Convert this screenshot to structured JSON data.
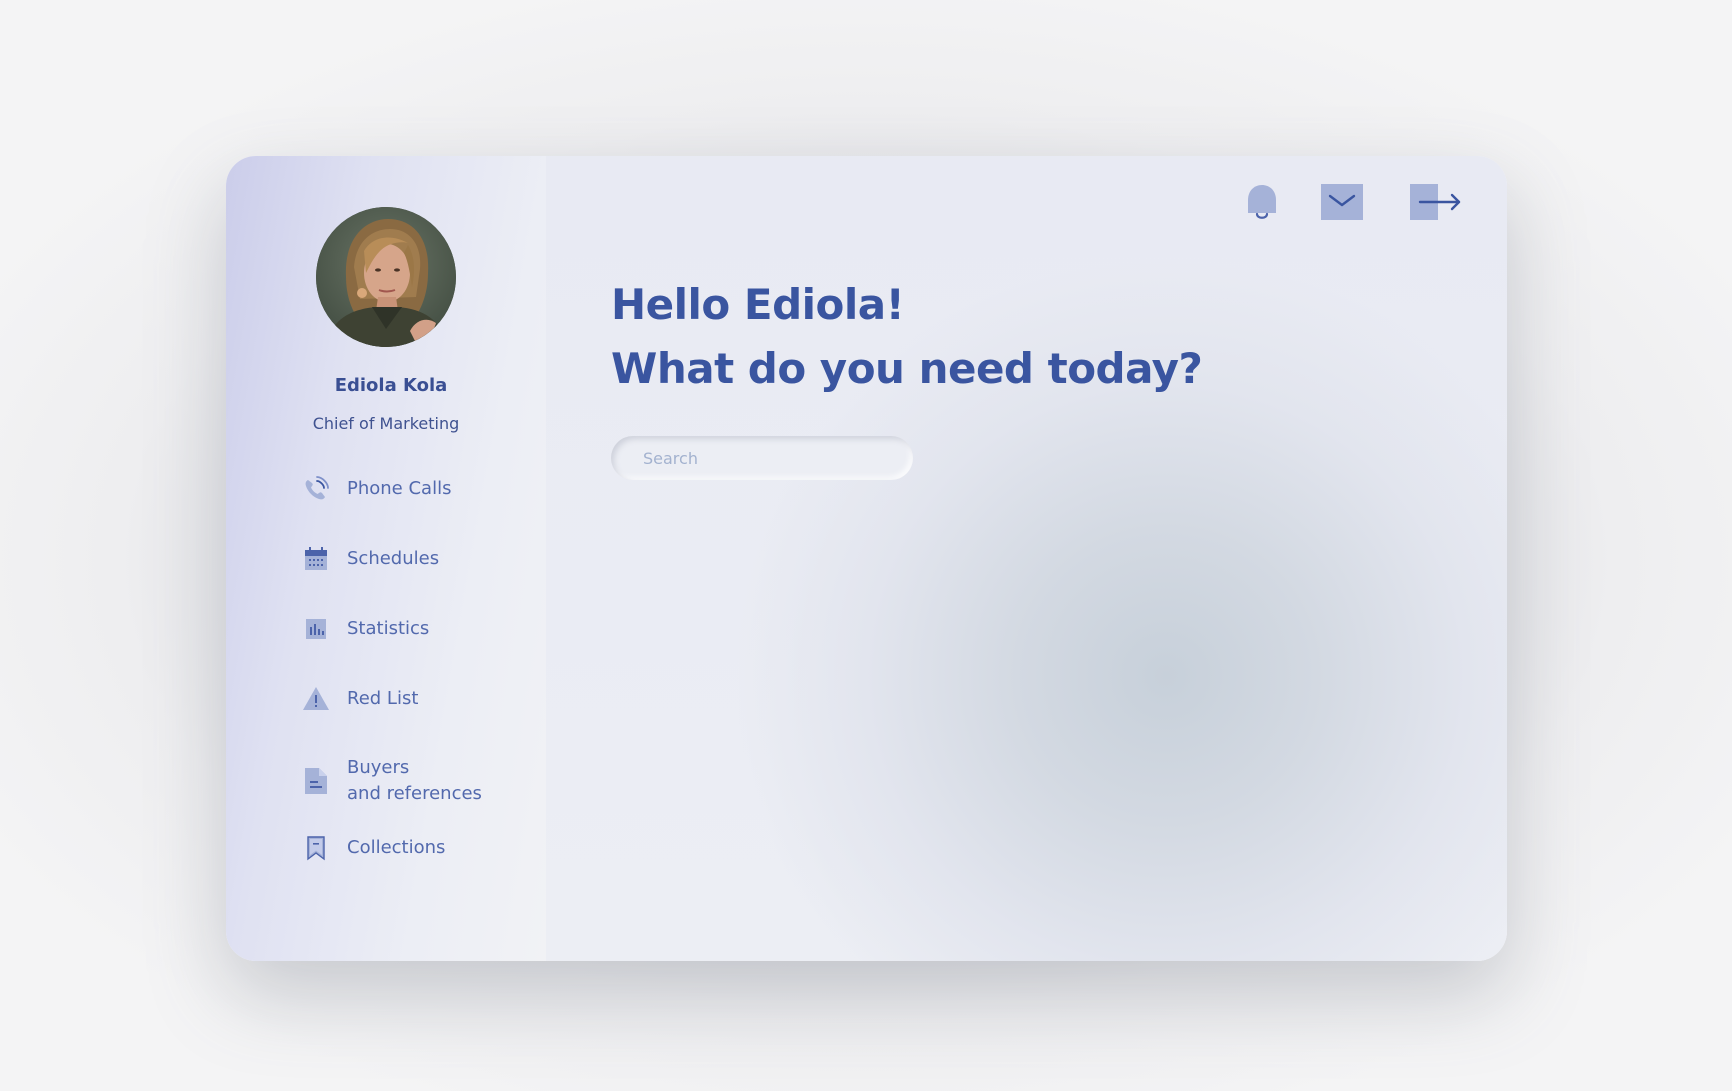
{
  "user": {
    "name": "Ediola Kola",
    "role": "Chief of Marketing"
  },
  "sidebar": {
    "items": [
      {
        "label": "Phone Calls",
        "icon": "phone-icon"
      },
      {
        "label": "Schedules",
        "icon": "calendar-icon"
      },
      {
        "label": "Statistics",
        "icon": "bar-chart-icon"
      },
      {
        "label": "Red List",
        "icon": "warning-icon"
      },
      {
        "label_line1": "Buyers",
        "label_line2": "and references",
        "icon": "document-icon"
      },
      {
        "label": "Collections",
        "icon": "bookmark-icon"
      }
    ]
  },
  "header": {
    "icons": [
      "bell-icon",
      "mail-icon",
      "logout-icon"
    ]
  },
  "main": {
    "greeting_line1": "Hello Ediola!",
    "greeting_line2": "What do you need today?",
    "search_placeholder": "Search"
  },
  "colors": {
    "accent": "#3a55a0",
    "icon": "#7e90c9",
    "nav_text": "#5269ad",
    "icon_fill": "#a5b2d8"
  }
}
